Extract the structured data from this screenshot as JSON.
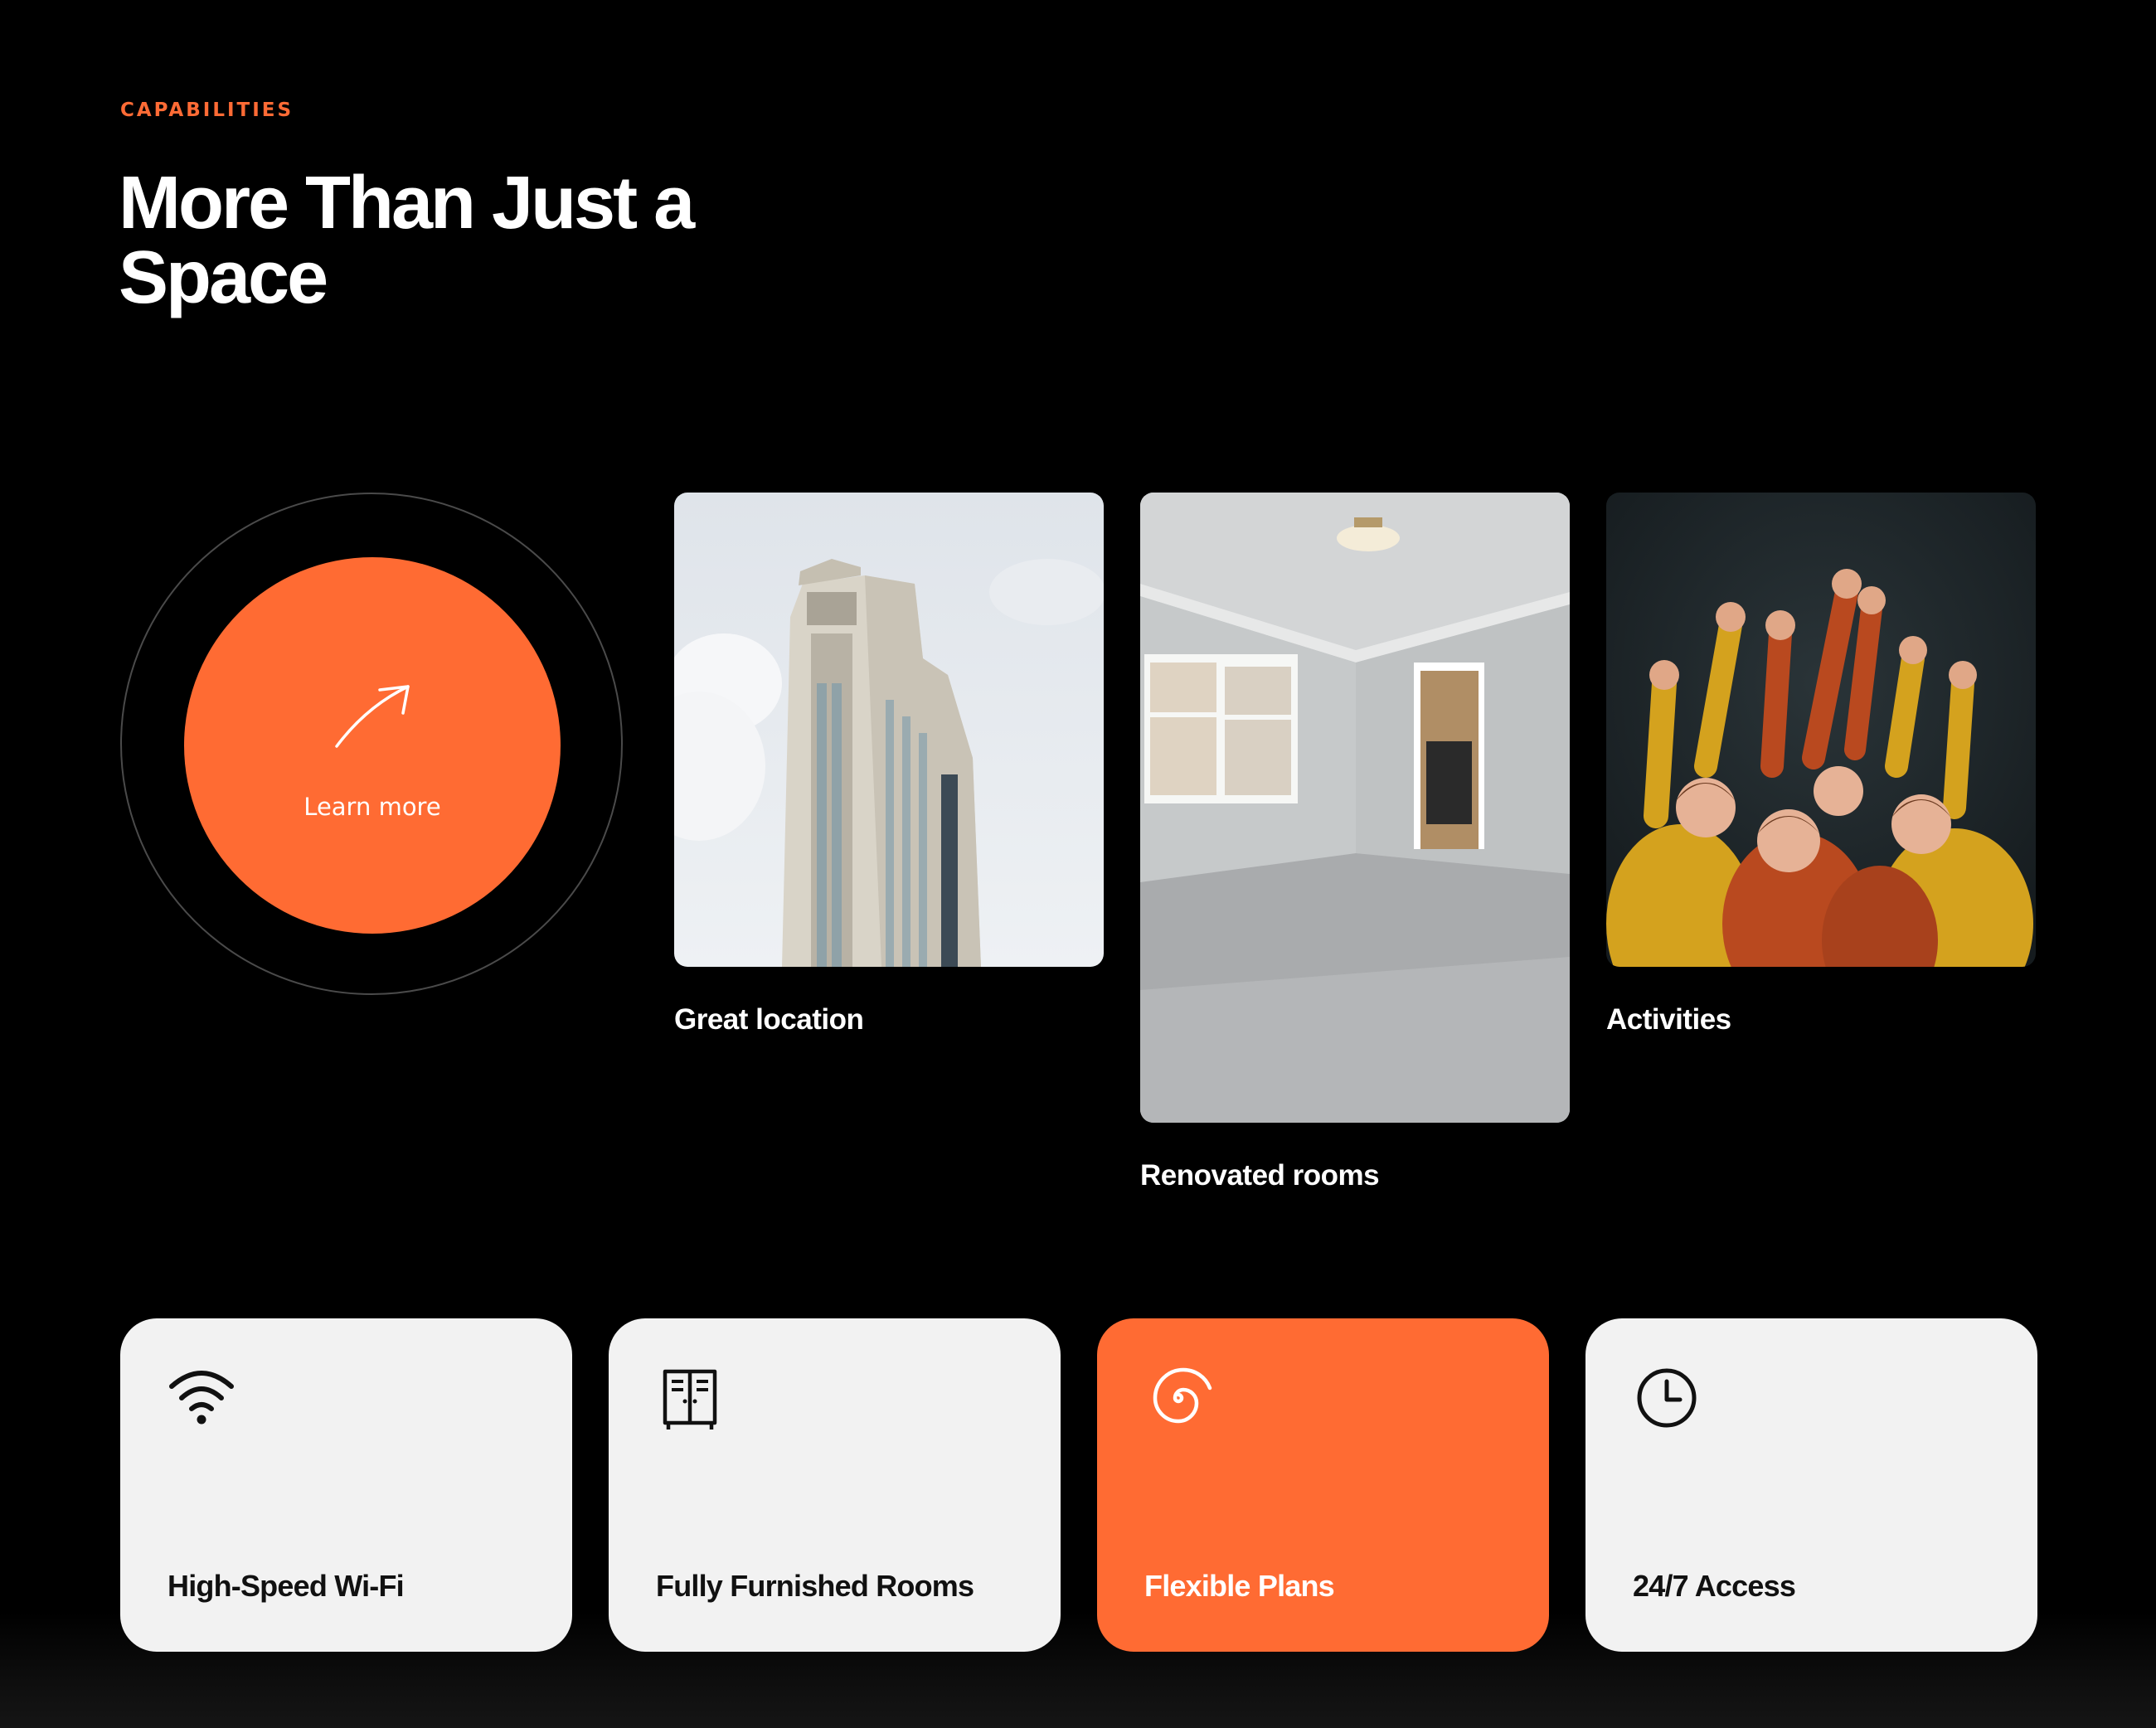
{
  "section": {
    "eyebrow": "CAPABILITIES",
    "title": "More Than Just a Space"
  },
  "cta": {
    "label": "Learn more",
    "icon": "arrow-up-right-icon"
  },
  "photos": [
    {
      "label": "Great location",
      "image": "skyscraper-photo"
    },
    {
      "label": "Renovated rooms",
      "image": "empty-room-photo"
    },
    {
      "label": "Activities",
      "image": "dancers-photo"
    }
  ],
  "features": [
    {
      "label": "High-Speed Wi-Fi",
      "icon": "wifi-icon",
      "active": false
    },
    {
      "label": "Fully Furnished Rooms",
      "icon": "wardrobe-icon",
      "active": false
    },
    {
      "label": "Flexible Plans",
      "icon": "spiral-icon",
      "active": true
    },
    {
      "label": "24/7 Access",
      "icon": "clock-icon",
      "active": false
    }
  ],
  "colors": {
    "accent": "#ff6b33",
    "background": "#000000",
    "card": "#f2f2f2"
  }
}
